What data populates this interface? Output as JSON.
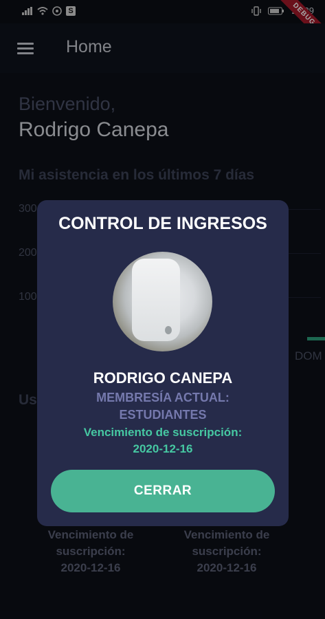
{
  "status_bar": {
    "time": "21:39",
    "badge": "S",
    "ribbon": "DEBUG"
  },
  "appbar": {
    "title": "Home"
  },
  "home": {
    "greeting": "Bienvenido,",
    "user_name": "Rodrigo Canepa",
    "attendance_title": "Mi asistencia en los últimos 7 días",
    "chart_y_ticks": [
      "300",
      "200",
      "100"
    ],
    "chart_x_label_partial": "DOM",
    "section_partial": "Us",
    "cards": [
      {
        "label": "Vencimiento de suscripción:",
        "date": "2020-12-16"
      },
      {
        "label": "Vencimiento de suscripción:",
        "date": "2020-12-16"
      }
    ]
  },
  "dialog": {
    "title": "CONTROL DE INGRESOS",
    "name": "RODRIGO CANEPA",
    "membership_label": "MEMBRESÍA ACTUAL:",
    "membership_value": "ESTUDIANTES",
    "expiry_label": "Vencimiento de suscripción:",
    "expiry_date": "2020-12-16",
    "close_label": "CERRAR"
  },
  "colors": {
    "accent": "#49b393",
    "dialog_bg": "#262b4a",
    "membership": "#7579ad",
    "expiry": "#46c8a2"
  }
}
